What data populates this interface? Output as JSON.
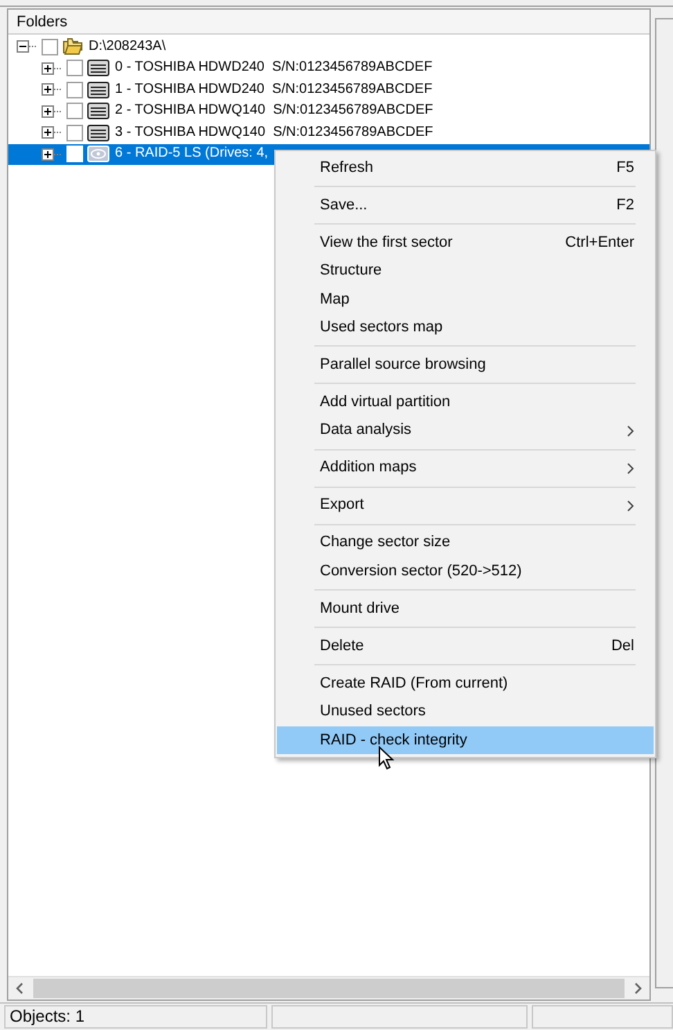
{
  "panel": {
    "title": "Folders"
  },
  "tree": [
    {
      "label": "D:\\208243A\\",
      "kind": "folder",
      "expanded": true,
      "checked": false,
      "selected": false,
      "children": [
        {
          "label": "0 - TOSHIBA HDWD240  S/N:0123456789ABCDEF",
          "kind": "disk",
          "expanded": false,
          "checked": false,
          "selected": false
        },
        {
          "label": "1 - TOSHIBA HDWD240  S/N:0123456789ABCDEF",
          "kind": "disk",
          "expanded": false,
          "checked": false,
          "selected": false
        },
        {
          "label": "2 - TOSHIBA HDWQ140  S/N:0123456789ABCDEF",
          "kind": "disk",
          "expanded": false,
          "checked": false,
          "selected": false
        },
        {
          "label": "3 - TOSHIBA HDWQ140  S/N:0123456789ABCDEF",
          "kind": "disk",
          "expanded": false,
          "checked": false,
          "selected": false
        },
        {
          "label": "6 - RAID-5 LS (Drives: 4,",
          "kind": "raid",
          "expanded": false,
          "checked": false,
          "selected": true
        }
      ]
    }
  ],
  "context_menu": [
    {
      "kind": "item",
      "label": "Refresh",
      "shortcut": "F5",
      "submenu": false,
      "selected": false
    },
    {
      "kind": "separator"
    },
    {
      "kind": "item",
      "label": "Save...",
      "shortcut": "F2",
      "submenu": false,
      "selected": false
    },
    {
      "kind": "separator"
    },
    {
      "kind": "item",
      "label": "View the first sector",
      "shortcut": "Ctrl+Enter",
      "submenu": false,
      "selected": false
    },
    {
      "kind": "item",
      "label": "Structure",
      "submenu": false,
      "selected": false
    },
    {
      "kind": "item",
      "label": "Map",
      "submenu": false,
      "selected": false
    },
    {
      "kind": "item",
      "label": "Used sectors map",
      "submenu": false,
      "selected": false
    },
    {
      "kind": "separator"
    },
    {
      "kind": "item",
      "label": "Parallel source browsing",
      "submenu": false,
      "selected": false
    },
    {
      "kind": "separator"
    },
    {
      "kind": "item",
      "label": "Add virtual partition",
      "submenu": false,
      "selected": false
    },
    {
      "kind": "item",
      "label": "Data analysis",
      "submenu": true,
      "selected": false
    },
    {
      "kind": "separator"
    },
    {
      "kind": "item",
      "label": "Addition maps",
      "submenu": true,
      "selected": false
    },
    {
      "kind": "separator"
    },
    {
      "kind": "item",
      "label": "Export",
      "submenu": true,
      "selected": false
    },
    {
      "kind": "separator"
    },
    {
      "kind": "item",
      "label": "Change sector size",
      "submenu": false,
      "selected": false
    },
    {
      "kind": "item",
      "label": "Conversion sector (520->512)",
      "submenu": false,
      "selected": false
    },
    {
      "kind": "separator"
    },
    {
      "kind": "item",
      "label": "Mount drive",
      "submenu": false,
      "selected": false
    },
    {
      "kind": "separator"
    },
    {
      "kind": "item",
      "label": "Delete",
      "shortcut": "Del",
      "submenu": false,
      "selected": false
    },
    {
      "kind": "separator"
    },
    {
      "kind": "item",
      "label": "Create RAID (From current)",
      "submenu": false,
      "selected": false
    },
    {
      "kind": "item",
      "label": "Unused sectors",
      "submenu": false,
      "selected": false
    },
    {
      "kind": "item",
      "label": "RAID - check integrity",
      "submenu": false,
      "selected": true
    }
  ],
  "status_bar": [
    {
      "text": "Objects: 1"
    }
  ]
}
